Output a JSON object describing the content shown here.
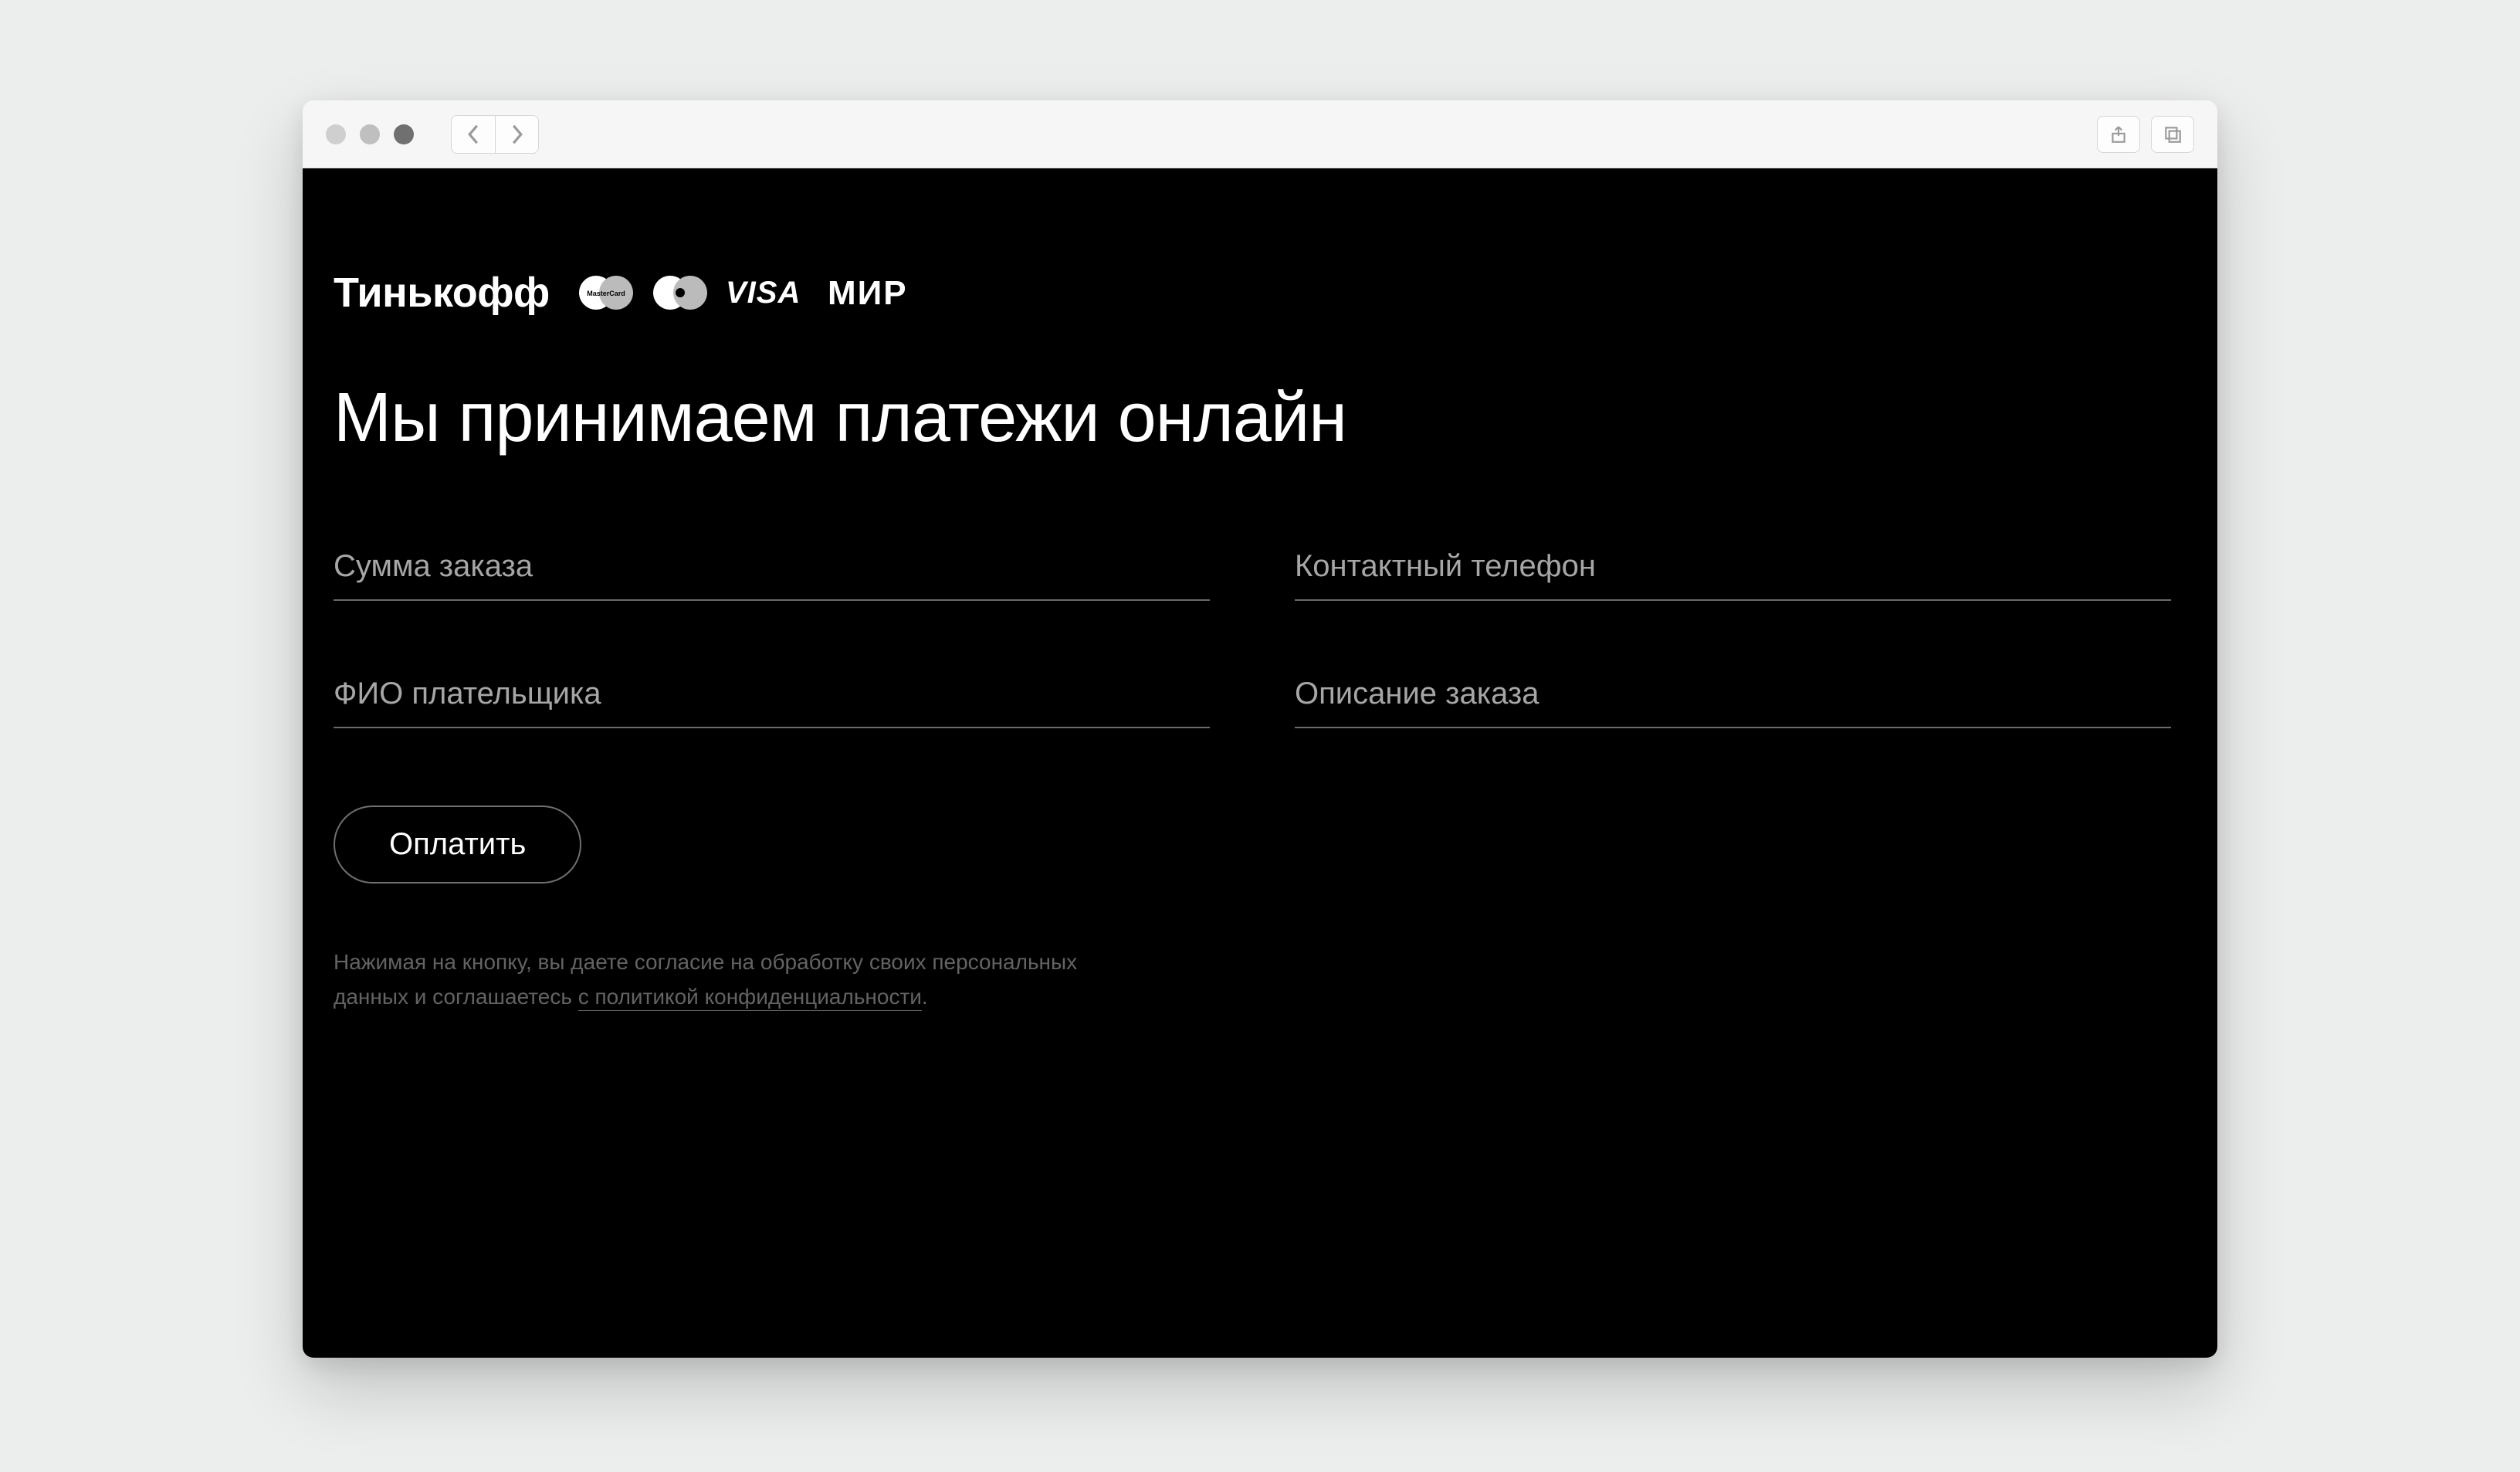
{
  "brand": {
    "name": "Тинькофф",
    "card_logos": [
      "mastercard",
      "maestro",
      "visa",
      "mir"
    ]
  },
  "heading": "Мы принимаем платежи онлайн",
  "form": {
    "amount": {
      "placeholder": "Сумма заказа",
      "value": ""
    },
    "phone": {
      "placeholder": "Контактный телефон",
      "value": ""
    },
    "payer_name": {
      "placeholder": "ФИО плательщика",
      "value": ""
    },
    "description": {
      "placeholder": "Описание заказа",
      "value": ""
    },
    "submit_label": "Оплатить"
  },
  "consent": {
    "text_prefix": "Нажимая на кнопку, вы даете согласие на обработку своих персональных данных и соглашаетесь ",
    "link_text": "с политикой конфиденциальности",
    "text_suffix": "."
  }
}
